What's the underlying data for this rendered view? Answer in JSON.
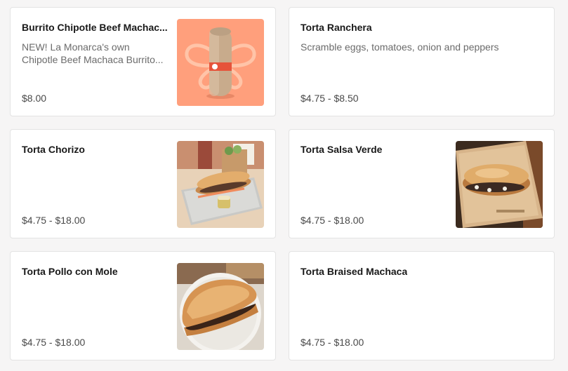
{
  "menu": {
    "items": [
      {
        "name": "Burrito Chipotle Beef Machac...",
        "description_lines": [
          "NEW! La Monarca's own",
          "Chipotle Beef Machaca Burrito..."
        ],
        "price": "$8.00",
        "image": "burrito-photo"
      },
      {
        "name": "Torta Ranchera",
        "description_lines": [
          "Scramble eggs, tomatoes, onion and peppers"
        ],
        "price": "$4.75 - $8.50"
      },
      {
        "name": "Torta Chorizo",
        "price": "$4.75 - $18.00",
        "image": "torta-chorizo-photo"
      },
      {
        "name": "Torta Salsa Verde",
        "price": "$4.75 - $18.00",
        "image": "torta-salsa-verde-photo"
      },
      {
        "name": "Torta Pollo con Mole",
        "price": "$4.75 - $18.00",
        "image": "torta-pollo-con-mole-photo"
      },
      {
        "name": "Torta Braised Machaca",
        "price": "$4.75 - $18.00"
      }
    ]
  },
  "colors": {
    "page_background": "#f6f5f5",
    "card_background": "#ffffff",
    "card_border": "#e3e3e3",
    "burrito_photo_background": "#ff9f7c"
  }
}
